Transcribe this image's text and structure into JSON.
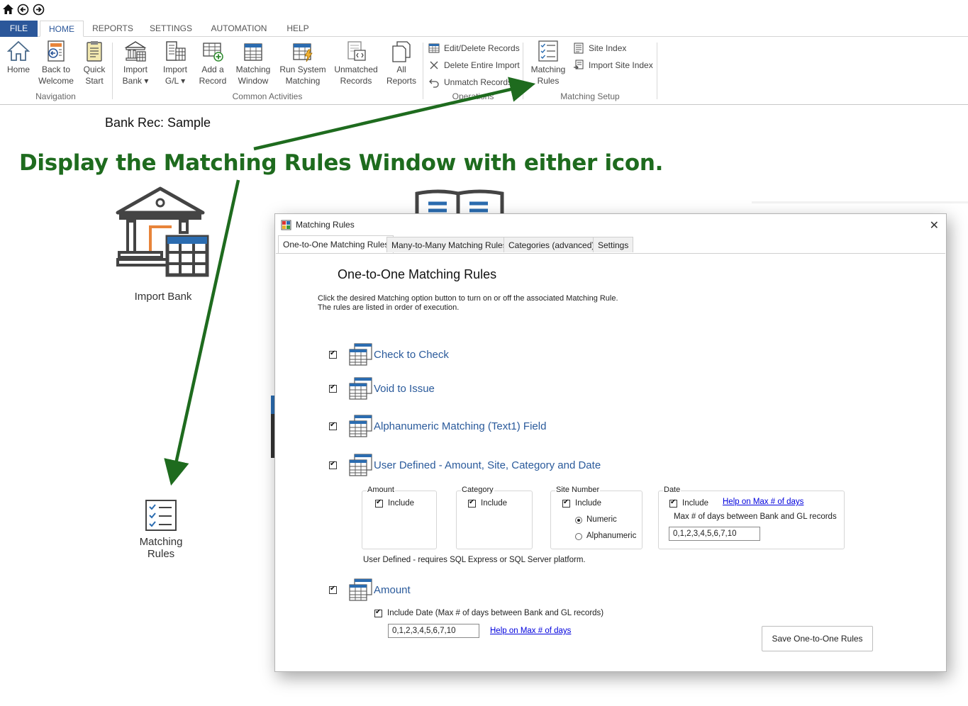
{
  "quick_access": {
    "icons": [
      "home-icon",
      "back-icon",
      "forward-icon"
    ]
  },
  "ribbon": {
    "tabs": [
      "FILE",
      "HOME",
      "REPORTS",
      "SETTINGS",
      "AUTOMATION",
      "HELP"
    ],
    "active_tab": "HOME",
    "groups": {
      "navigation": {
        "label": "Navigation",
        "buttons": [
          {
            "line1": "Home",
            "line2": "",
            "icon": "home-icon"
          },
          {
            "line1": "Back to",
            "line2": "Welcome",
            "icon": "back-to-welcome-icon"
          },
          {
            "line1": "Quick",
            "line2": "Start",
            "icon": "clipboard-icon"
          }
        ]
      },
      "common_activities": {
        "label": "Common Activities",
        "buttons": [
          {
            "line1": "Import",
            "line2": "Bank ▾",
            "icon": "bank-icon"
          },
          {
            "line1": "Import",
            "line2": "G/L ▾",
            "icon": "ledger-icon"
          },
          {
            "line1": "Add a",
            "line2": "Record",
            "icon": "add-record-icon"
          },
          {
            "line1": "Matching",
            "line2": "Window",
            "icon": "matching-window-icon"
          },
          {
            "line1": "Run System",
            "line2": "Matching",
            "icon": "run-matching-icon"
          },
          {
            "line1": "Unmatched",
            "line2": "Records",
            "icon": "unmatched-records-icon"
          },
          {
            "line1": "All",
            "line2": "Reports",
            "icon": "reports-icon"
          }
        ]
      },
      "operations": {
        "label": "Operations",
        "buttons": [
          "Edit/Delete Records",
          "Delete Entire Import",
          "Unmatch Records"
        ]
      },
      "matching_setup": {
        "label": "Matching Setup",
        "big_button": {
          "line1": "Matching",
          "line2": "Rules",
          "icon": "checklist-icon"
        },
        "buttons": [
          "Site Index",
          "Import Site Index"
        ]
      }
    }
  },
  "page": {
    "title": "Bank Rec: Sample",
    "annotation": "Display the Matching Rules Window with either icon.",
    "import_bank_label": "Import Bank",
    "matching_rules_line1": "Matching",
    "matching_rules_line2": "Rules"
  },
  "dialog": {
    "title": "Matching Rules",
    "tabs": [
      "One-to-One Matching Rules",
      "Many-to-Many Matching Rules",
      "Categories (advanced)",
      "Settings"
    ],
    "heading": "One-to-One Matching Rules",
    "instructions_line1": "Click the desired Matching option button to turn on or off the associated Matching Rule.",
    "instructions_line2": "The rules are listed in order of execution.",
    "rules": [
      {
        "label": "Check to Check",
        "checked": true
      },
      {
        "label": "Void to Issue",
        "checked": true
      },
      {
        "label": "Alphanumeric Matching (Text1) Field",
        "checked": true
      },
      {
        "label": "User Defined - Amount, Site, Category and Date",
        "checked": true
      },
      {
        "label": "Amount",
        "checked": true
      }
    ],
    "user_defined": {
      "amount": {
        "title": "Amount",
        "include": "Include"
      },
      "category": {
        "title": "Category",
        "include": "Include"
      },
      "site_number": {
        "title": "Site Number",
        "include": "Include",
        "options": [
          "Numeric",
          "Alphanumeric"
        ],
        "selected": "Numeric"
      },
      "date": {
        "title": "Date",
        "include": "Include",
        "help_link": "Help on Max # of days",
        "max_days_label": "Max # of days between Bank and GL records",
        "max_days_value": "0,1,2,3,4,5,6,7,10"
      },
      "note": "User Defined - requires SQL Express or SQL Server platform."
    },
    "amount_rule": {
      "include_date_label": "Include Date (Max # of days between Bank and GL records)",
      "max_days_value": "0,1,2,3,4,5,6,7,10",
      "help_link": "Help on Max # of days"
    },
    "save_button": "Save One-to-One Rules"
  },
  "colors": {
    "accent": "#2b579a",
    "annotation": "#1e6b1e",
    "rule_label": "#2a5a9b",
    "link": "#0000dd"
  }
}
